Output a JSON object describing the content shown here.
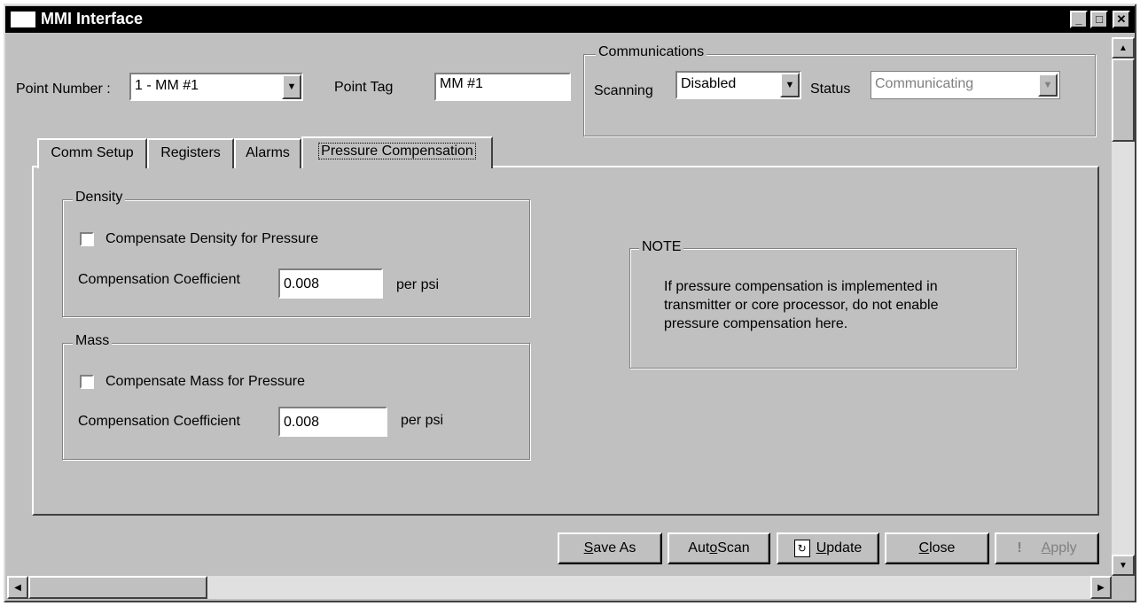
{
  "window": {
    "title": "MMI Interface",
    "minimize": "_",
    "maximize": "□",
    "close": "✕"
  },
  "header": {
    "point_number_label": "Point Number :",
    "point_number_value": "1 - MM #1",
    "point_tag_label": "Point Tag",
    "point_tag_value": "MM #1"
  },
  "communications": {
    "legend": "Communications",
    "scanning_label": "Scanning",
    "scanning_value": "Disabled",
    "status_label": "Status",
    "status_value": "Communicating"
  },
  "tabs": [
    {
      "label": "Comm Setup"
    },
    {
      "label": "Registers"
    },
    {
      "label": "Alarms"
    },
    {
      "label": "Pressure Compensation"
    }
  ],
  "density": {
    "legend": "Density",
    "checkbox_label": "Compensate Density for Pressure",
    "coef_label": "Compensation Coefficient",
    "coef_value": "0.008",
    "unit": "per psi"
  },
  "mass": {
    "legend": "Mass",
    "checkbox_label": "Compensate Mass for Pressure",
    "coef_label": "Compensation Coefficient",
    "coef_value": "0.008",
    "unit": "per psi"
  },
  "note": {
    "legend": "NOTE",
    "line1": "If pressure compensation is implemented in",
    "line2": "transmitter or core processor, do not enable",
    "line3": "pressure compensation here."
  },
  "buttons": {
    "save_as_pre": "",
    "save_as_u": "S",
    "save_as_post": "ave As",
    "auto_scan_pre": "Aut",
    "auto_scan_u": "o",
    "auto_scan_post": " Scan",
    "update_pre": "",
    "update_u": "U",
    "update_post": "pdate",
    "close_pre": "",
    "close_u": "C",
    "close_post": "lose",
    "apply_pre": "",
    "apply_u": "A",
    "apply_post": "pply"
  },
  "icons": {
    "dropdown": "dropdown-arrow-icon",
    "update": "refresh-icon",
    "apply": "exclamation-icon"
  }
}
